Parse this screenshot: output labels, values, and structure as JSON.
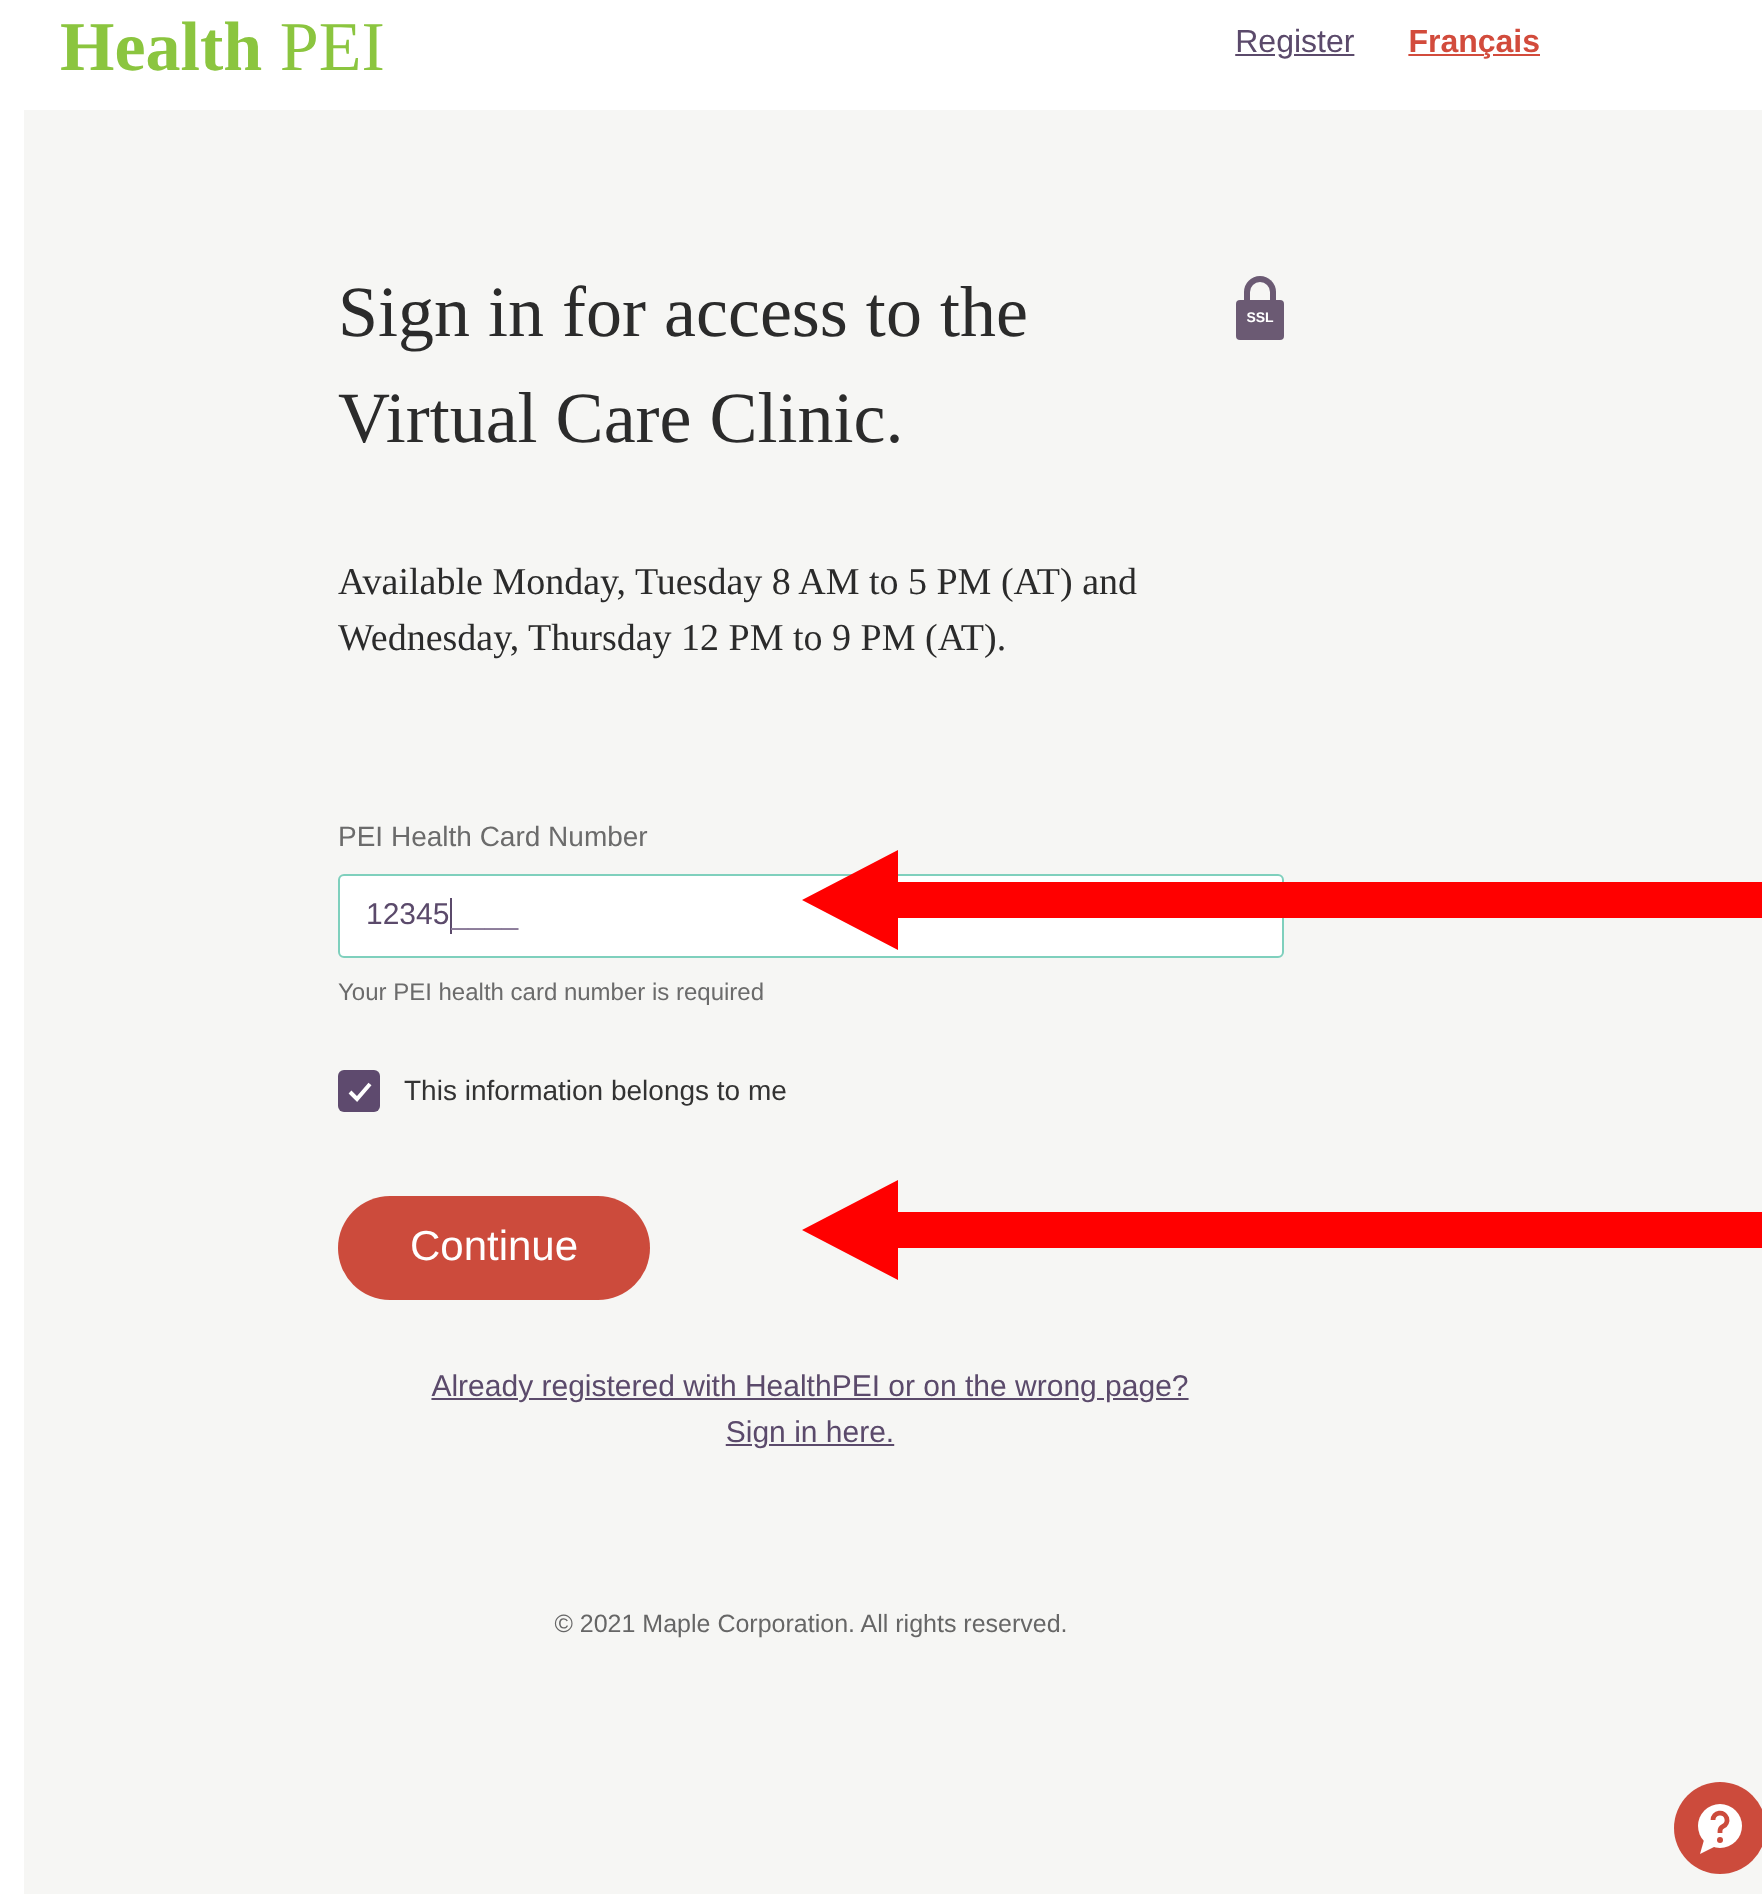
{
  "header": {
    "logo": {
      "bold": "Health",
      "light": "PEI"
    },
    "links": [
      {
        "label": "Register",
        "kind": "plain"
      },
      {
        "label": "Français",
        "kind": "accent"
      }
    ]
  },
  "main": {
    "title_lines": [
      "Sign in for access to the",
      "Virtual Care Clinic."
    ],
    "lock_badge": "SSL",
    "availability_lines": [
      "Available Monday, Tuesday 8 AM to 5 PM (AT) and",
      "Wednesday, Thursday 12 PM to 9 PM (AT)."
    ],
    "field": {
      "label": "PEI Health Card Number",
      "value": "12345",
      "mask": "____",
      "hint": "Your PEI health card number is required"
    },
    "checkbox": {
      "label": "This information belongs to me",
      "checked": true
    },
    "button": "Continue",
    "signin_link_lines": [
      "Already registered with HealthPEI or on the wrong page?",
      "Sign in here."
    ],
    "footer": "© 2021 Maple Corporation. All rights reserved."
  }
}
